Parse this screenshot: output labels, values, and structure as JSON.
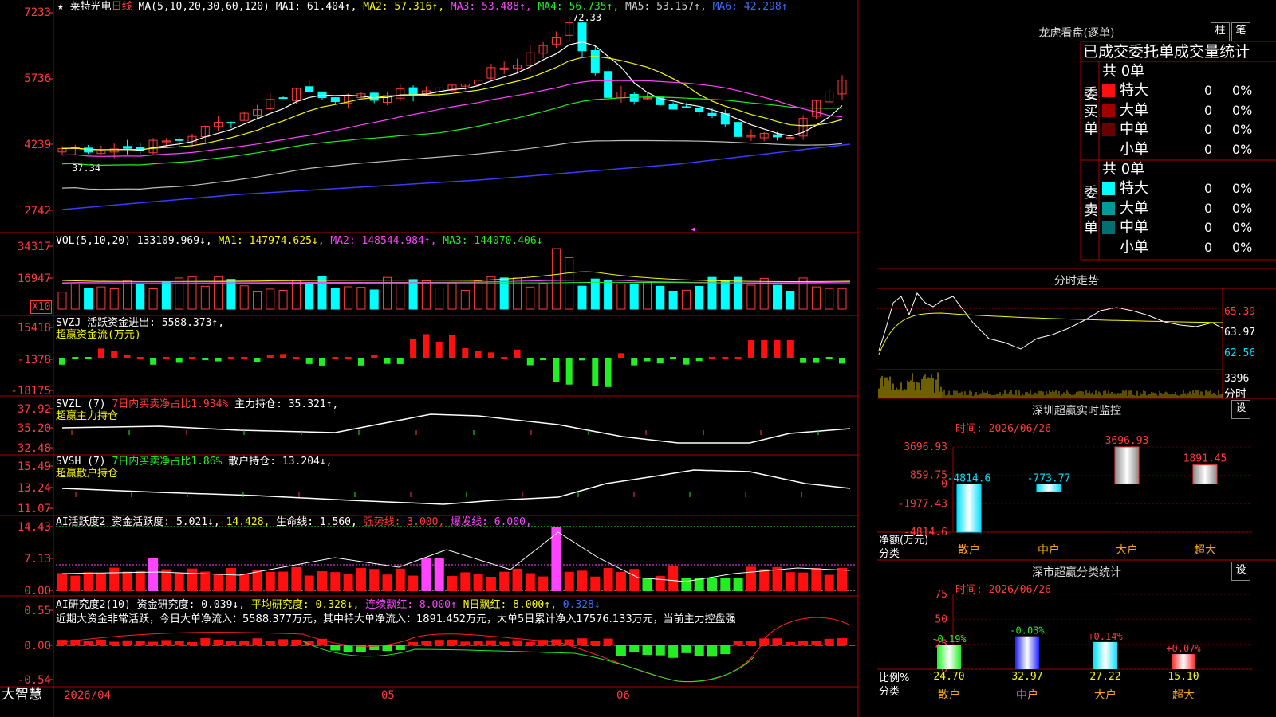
{
  "header": {
    "star": "★",
    "stock_name": "莱特光电",
    "period": "日线",
    "ma_spec": "MA(5,10,20,30,60,120)",
    "ma1": "MA1: 61.404↑,",
    "ma2": "MA2: 57.316↑,",
    "ma3": "MA3: 53.488↑,",
    "ma4": "MA4: 56.735↑,",
    "ma5": "MA5: 53.157↑,",
    "ma6": "MA6: 42.298↑",
    "high_marker": "72.33",
    "low_marker": "37.34"
  },
  "price_axis": [
    "7233",
    "5736",
    "4239",
    "2742"
  ],
  "vol": {
    "spec": "VOL(5,10,20)",
    "value": "133109.969↓,",
    "ma1": "MA1: 147974.625↓,",
    "ma2": "MA2: 148544.984↑,",
    "ma3": "MA3: 144070.406↓",
    "axis": [
      "34317",
      "16947"
    ],
    "scale": "X10"
  },
  "svzj": {
    "title": "SVZJ  活跃资金进出: 5588.373↑,",
    "subtitle": "超赢资金流(万元)",
    "axis": [
      "15418",
      "-1378",
      "-18175"
    ]
  },
  "svzl": {
    "title_a": "SVZL (7)",
    "title_b": "7日内买卖净占比1.934%",
    "title_c": "主力持仓: 35.321↑,",
    "subtitle": "超赢主力持仓",
    "axis": [
      "37.92",
      "35.20",
      "32.48"
    ]
  },
  "svsh": {
    "title_a": "SVSH (7)",
    "title_b": "7日内买卖净占比1.86%",
    "title_c": "散户持仓: 13.204↓,",
    "subtitle": "超赢散户持仓",
    "axis": [
      "15.49",
      "13.24",
      "11.07"
    ]
  },
  "ai_active": {
    "title_a": "AI活跃度2 资金活跃度: 5.021↓,",
    "title_b": "14.428,",
    "title_c": "生命线: 1.560,",
    "title_d": "强势线: 3.000,",
    "title_e": "爆发线: 6.000,",
    "axis": [
      "14.43",
      "7.13",
      "0.00"
    ]
  },
  "ai_research": {
    "title_a": "AI研究度2(10)",
    "title_b": "资金研究度: 0.039↓,",
    "title_c": "平均研究度: 0.328↓,",
    "title_d": "连续飘红: 8.000↑",
    "title_e": "N日飘红: 8.000↑,",
    "title_f": "0.328↓",
    "note": "近期大资金非常活跃，今日大单净流入：5588.377万元，其中特大单净流入：1891.452万元，大单5日累计净入17576.133万元，当前主力控盘强",
    "axis": [
      "0.55",
      "0.00",
      "-0.54"
    ]
  },
  "date_axis": {
    "brand": "大智慧",
    "d1": "2026/04",
    "d2": "05",
    "d3": "06"
  },
  "dragon_tiger": {
    "title": "龙虎看盘(逐单)",
    "btn1": "柱",
    "btn2": "笔",
    "sub": "已成交委托单成交量统计",
    "buy_label": "委买单",
    "sell_label": "委卖单",
    "buy_total": "共 0单",
    "sell_total": "共 0单",
    "buy_rows": [
      {
        "label": "特大",
        "v": "0",
        "p": "0%",
        "color": "#ff1010"
      },
      {
        "label": "大单",
        "v": "0",
        "p": "0%",
        "color": "#a00000"
      },
      {
        "label": "中单",
        "v": "0",
        "p": "0%",
        "color": "#6a0000"
      },
      {
        "label": "小单",
        "v": "0",
        "p": "0%",
        "color": "#000000"
      }
    ],
    "sell_rows": [
      {
        "label": "特大",
        "v": "0",
        "p": "0%",
        "color": "#00ffff"
      },
      {
        "label": "大单",
        "v": "0",
        "p": "0%",
        "color": "#009a9a"
      },
      {
        "label": "中单",
        "v": "0",
        "p": "0%",
        "color": "#007070"
      },
      {
        "label": "小单",
        "v": "0",
        "p": "0%",
        "color": "#000000"
      }
    ]
  },
  "intraday": {
    "title": "分时走势",
    "axis": [
      "65.39",
      "63.97",
      "62.56",
      "3396"
    ],
    "vol_label": "分时"
  },
  "sz_monitor": {
    "title": "深圳超赢实时监控",
    "btn": "设",
    "time": "时间: 2026/06/26",
    "axis": [
      "3696.93",
      "859.75",
      "0",
      "-1977.43",
      "-4814.6"
    ],
    "side_label_1": "净额(万元)",
    "side_label_2": "分类",
    "categories": [
      "散户",
      "中户",
      "大户",
      "超大"
    ],
    "values": [
      -4814.6,
      -773.77,
      3696.93,
      1891.45
    ],
    "value_labels": [
      "-4814.6",
      "-773.77",
      "3696.93",
      "1891.45"
    ]
  },
  "sz_class": {
    "title": "深市超赢分类统计",
    "btn": "设",
    "time": "时间: 2026/06/26",
    "axis": [
      "75",
      "50",
      "25",
      "0"
    ],
    "side_label_1": "比例%",
    "side_label_2": "分类",
    "categories": [
      "散户",
      "中户",
      "大户",
      "超大"
    ],
    "values": [
      24.7,
      32.97,
      27.22,
      15.1
    ],
    "value_labels": [
      "24.70",
      "32.97",
      "27.22",
      "15.10"
    ],
    "changes": [
      "-0.19%",
      "-0.03%",
      "+0.14%",
      "+0.07%"
    ]
  },
  "chart_data": [
    {
      "type": "bar",
      "title": "深圳超赢实时监控",
      "categories": [
        "散户",
        "中户",
        "大户",
        "超大"
      ],
      "values": [
        -4814.6,
        -773.77,
        3696.93,
        1891.45
      ],
      "ylabel": "净额(万元)",
      "ylim": [
        -4814.6,
        3696.93
      ]
    },
    {
      "type": "bar",
      "title": "深市超赢分类统计",
      "categories": [
        "散户",
        "中户",
        "大户",
        "超大"
      ],
      "values": [
        24.7,
        32.97,
        27.22,
        15.1
      ],
      "ylabel": "比例%",
      "ylim": [
        0,
        75
      ]
    }
  ]
}
